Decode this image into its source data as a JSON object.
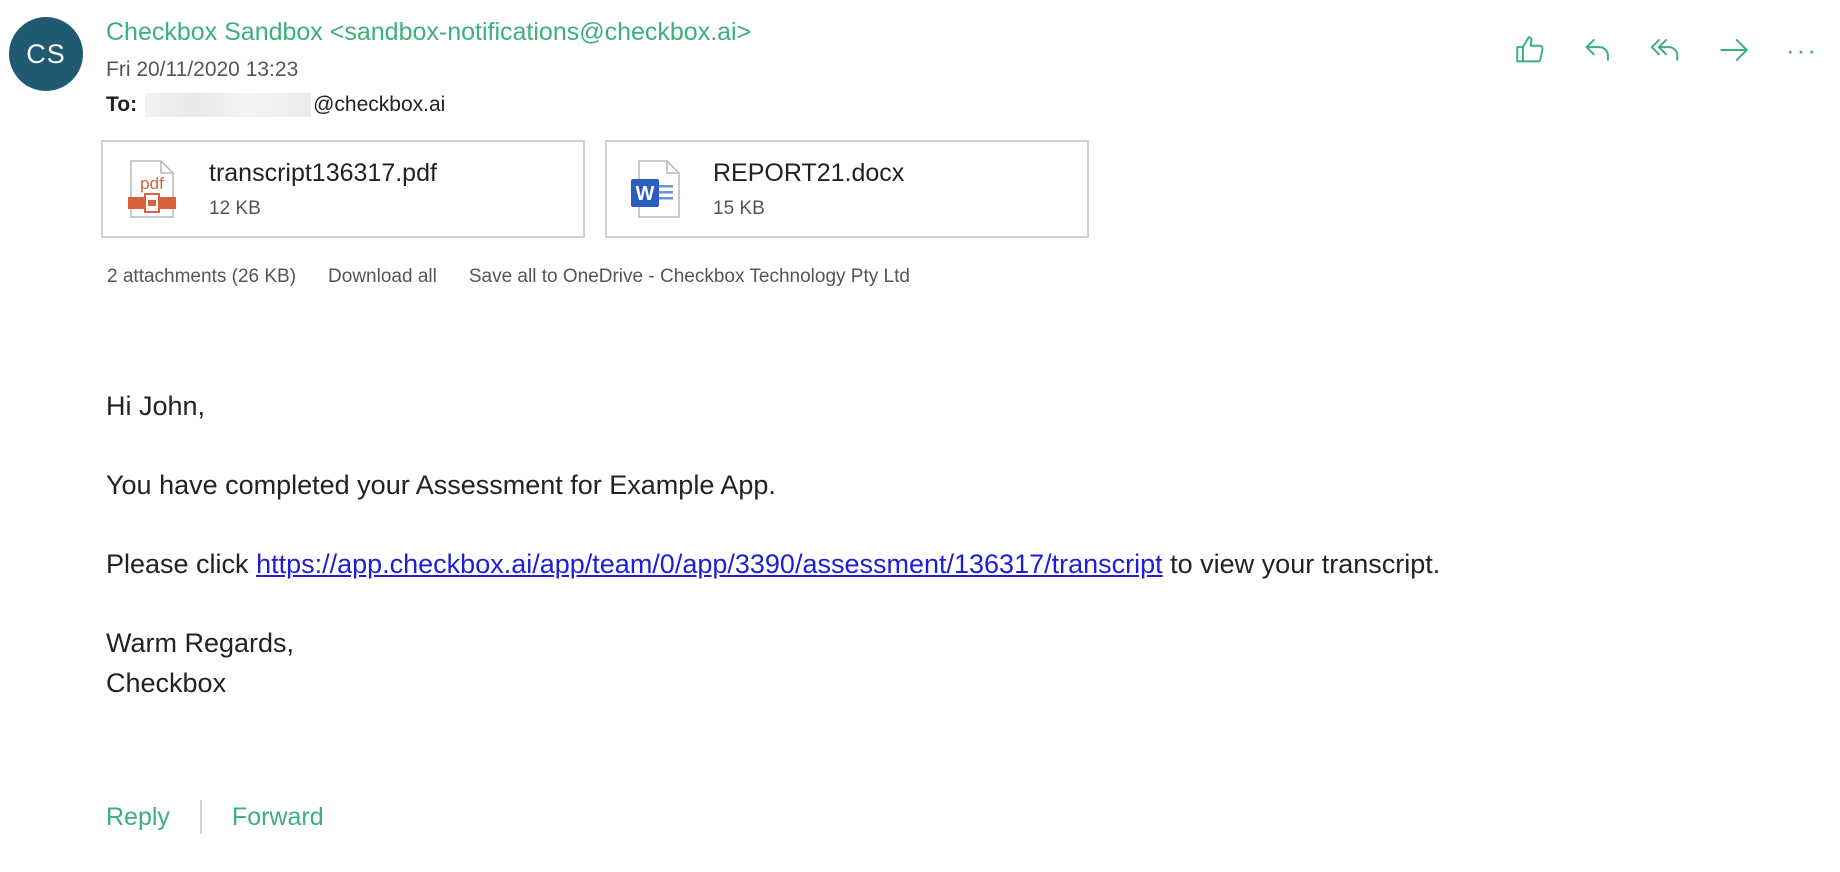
{
  "header": {
    "avatar_initials": "CS",
    "sender": "Checkbox Sandbox <sandbox-notifications@checkbox.ai>",
    "date": "Fri 20/11/2020 13:23",
    "to_label": "To:",
    "to_domain": "@checkbox.ai"
  },
  "toolbar": {
    "icons": [
      "like-icon",
      "reply-icon",
      "reply-all-icon",
      "forward-icon",
      "more-icon"
    ],
    "more_glyph": "···"
  },
  "attachments": {
    "items": [
      {
        "name": "transcript136317.pdf",
        "size": "12 KB",
        "icon": "pdf-file-icon"
      },
      {
        "name": "REPORT21.docx",
        "size": "15 KB",
        "icon": "word-file-icon"
      }
    ],
    "summary": "2 attachments (26 KB)",
    "download_all": "Download all",
    "save_onedrive": "Save all to OneDrive - Checkbox Technology Pty Ltd"
  },
  "body": {
    "greeting": "Hi John,",
    "line1": "You have completed your Assessment for Example App.",
    "line2_prefix": "Please click ",
    "link": "https://app.checkbox.ai/app/team/0/app/3390/assessment/136317/transcript",
    "line2_suffix": " to view your transcript.",
    "sign_off": "Warm Regards,",
    "signature": "Checkbox"
  },
  "footer": {
    "reply": "Reply",
    "forward": "Forward"
  },
  "colors": {
    "accent": "#3cb07a",
    "avatar": "#1f5a72",
    "link": "#1d1ed6"
  }
}
